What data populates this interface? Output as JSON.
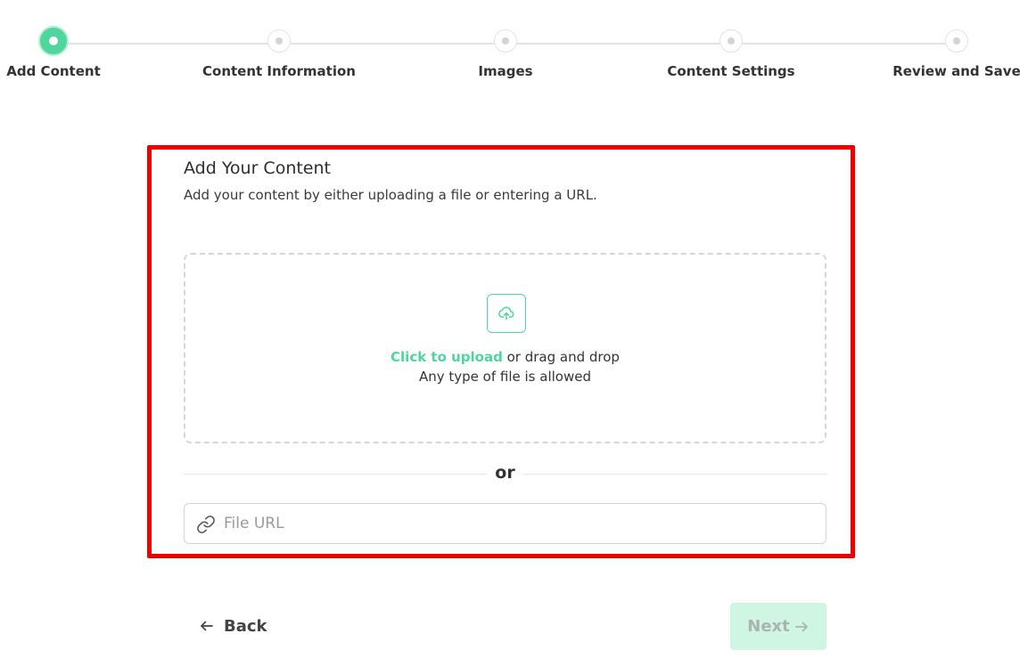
{
  "stepper": {
    "steps": [
      {
        "label": "Add Content",
        "state": "active"
      },
      {
        "label": "Content Information",
        "state": "pending"
      },
      {
        "label": "Images",
        "state": "pending"
      },
      {
        "label": "Content Settings",
        "state": "pending"
      },
      {
        "label": "Review and Save",
        "state": "pending"
      }
    ]
  },
  "card": {
    "title": "Add Your Content",
    "subtitle": "Add your content by either uploading a file or entering a URL."
  },
  "dropzone": {
    "icon": "upload-cloud-icon",
    "link_text": "Click to upload",
    "rest_text": " or drag and drop",
    "hint": "Any type of file is allowed"
  },
  "divider": {
    "text": "or"
  },
  "url_field": {
    "icon": "link-icon",
    "placeholder": "File URL",
    "value": ""
  },
  "footer": {
    "back_label": "Back",
    "back_icon": "arrow-left-icon",
    "next_label": "Next",
    "next_icon": "arrow-right-icon",
    "next_enabled": false
  },
  "colors": {
    "accent": "#4fd69c",
    "highlight_frame": "#ee0000",
    "next_disabled_bg": "#cff5e3"
  }
}
